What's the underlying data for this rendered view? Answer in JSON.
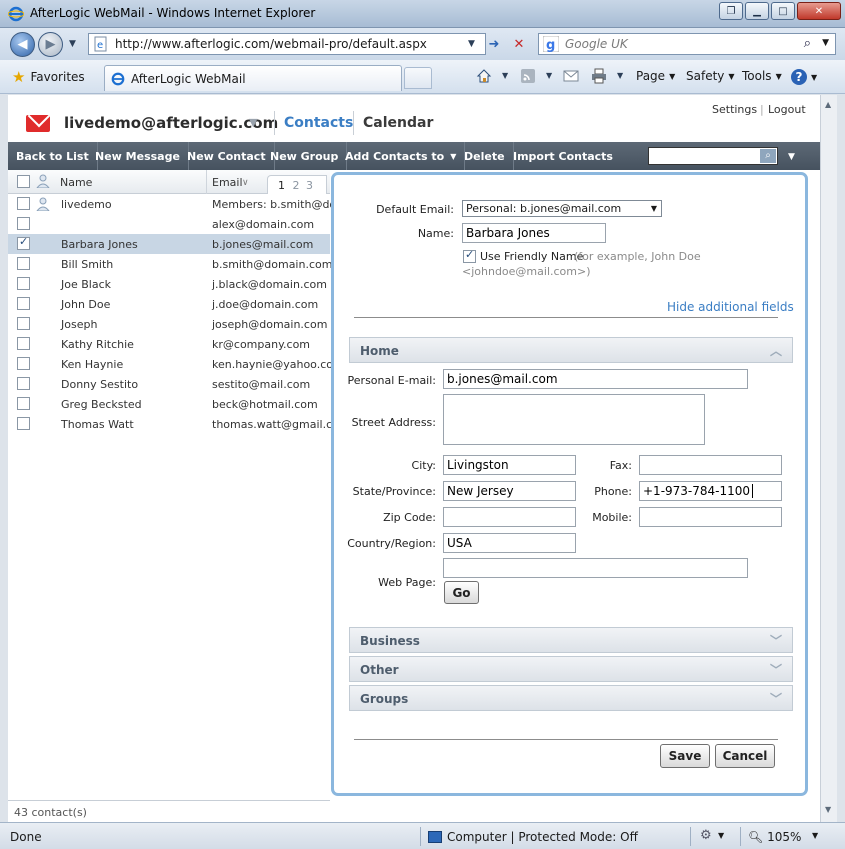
{
  "browser": {
    "title": "AfterLogic WebMail - Windows Internet Explorer",
    "url": "http://www.afterlogic.com/webmail-pro/default.aspx",
    "search_placeholder": "Google UK",
    "favorites_label": "Favorites",
    "tab_title": "AfterLogic WebMail",
    "commands": {
      "page": "Page",
      "safety": "Safety",
      "tools": "Tools",
      "help": "?"
    },
    "status": {
      "left": "Done",
      "zone": "Computer | Protected Mode: Off",
      "zoom": "105%"
    }
  },
  "app": {
    "account": "livedemo@afterlogic.com",
    "nav": {
      "contacts": "Contacts",
      "calendar": "Calendar"
    },
    "top_links": {
      "settings": "Settings",
      "logout": "Logout"
    },
    "toolbar": {
      "back_to_list": "Back to List",
      "new_message": "New Message",
      "new_contact": "New Contact",
      "new_group": "New Group",
      "add_contacts_to": "Add Contacts to",
      "delete": "Delete",
      "import_contacts": "Import Contacts"
    },
    "list": {
      "col_name": "Name",
      "col_email": "Email",
      "pages": [
        "1",
        "2",
        "3"
      ],
      "rows": [
        {
          "name": "livedemo",
          "email": "Members: b.smith@domain.com",
          "group": true,
          "selected": false
        },
        {
          "name": "",
          "email": "alex@domain.com",
          "group": false,
          "selected": false
        },
        {
          "name": "Barbara Jones",
          "email": "b.jones@mail.com",
          "group": false,
          "selected": true
        },
        {
          "name": "Bill Smith",
          "email": "b.smith@domain.com",
          "group": false,
          "selected": false
        },
        {
          "name": "Joe Black",
          "email": "j.black@domain.com",
          "group": false,
          "selected": false
        },
        {
          "name": "John Doe",
          "email": "j.doe@domain.com",
          "group": false,
          "selected": false
        },
        {
          "name": "Joseph",
          "email": "joseph@domain.com",
          "group": false,
          "selected": false
        },
        {
          "name": "Kathy Ritchie",
          "email": "kr@company.com",
          "group": false,
          "selected": false
        },
        {
          "name": "Ken Haynie",
          "email": "ken.haynie@yahoo.com",
          "group": false,
          "selected": false
        },
        {
          "name": "Donny Sestito",
          "email": "sestito@mail.com",
          "group": false,
          "selected": false
        },
        {
          "name": "Greg Becksted",
          "email": "beck@hotmail.com",
          "group": false,
          "selected": false
        },
        {
          "name": "Thomas Watt",
          "email": "thomas.watt@gmail.com",
          "group": false,
          "selected": false
        }
      ],
      "count": "43 contact(s)"
    },
    "form": {
      "default_email_label": "Default Email:",
      "default_email_value": "Personal: b.jones@mail.com",
      "name_label": "Name:",
      "name_value": "Barbara Jones",
      "friendly_label": "Use Friendly Name",
      "friendly_hint_1": "(for example, John Doe",
      "friendly_hint_2": "<johndoe@mail.com>)",
      "hide_fields": "Hide additional fields",
      "sections": {
        "home": "Home",
        "business": "Business",
        "other": "Other",
        "groups": "Groups"
      },
      "home": {
        "personal_email_label": "Personal E-mail:",
        "personal_email_value": "b.jones@mail.com",
        "street_label": "Street Address:",
        "street_value": "",
        "city_label": "City:",
        "city_value": "Livingston",
        "fax_label": "Fax:",
        "fax_value": "",
        "state_label": "State/Province:",
        "state_value": "New Jersey",
        "phone_label": "Phone:",
        "phone_value": "+1-973-784-1100",
        "zip_label": "Zip Code:",
        "zip_value": "",
        "mobile_label": "Mobile:",
        "mobile_value": "",
        "country_label": "Country/Region:",
        "country_value": "USA",
        "web_label": "Web Page:",
        "web_value": "",
        "go_label": "Go"
      },
      "save_label": "Save",
      "cancel_label": "Cancel"
    }
  },
  "colors": {
    "accent": "#3b7ec4",
    "toolbar": "#4f5b68",
    "selection": "#c8d6e4",
    "panel_border": "#8bb7de",
    "mail_icon": "#e02b2b"
  }
}
